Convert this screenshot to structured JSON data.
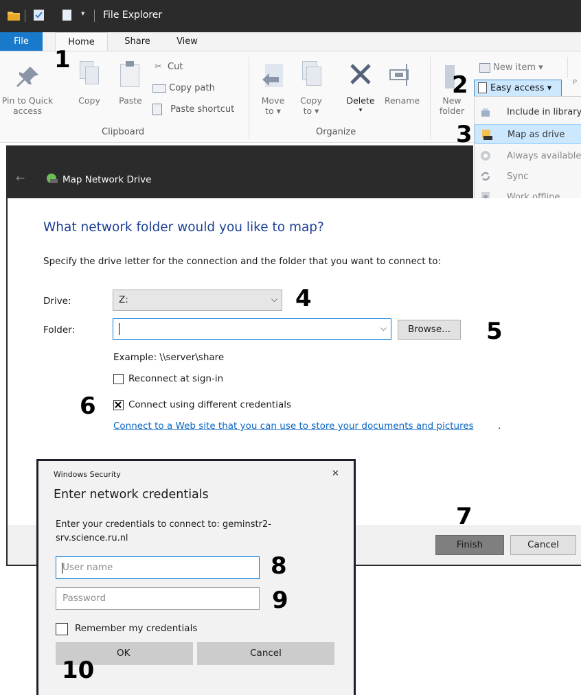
{
  "window": {
    "title": "File Explorer"
  },
  "tabs": {
    "file": "File",
    "home": "Home",
    "share": "Share",
    "view": "View"
  },
  "ribbon": {
    "pin_line1": "Pin to Quick",
    "pin_line2": "access",
    "copy": "Copy",
    "paste": "Paste",
    "cut": "Cut",
    "copy_path": "Copy path",
    "paste_shortcut": "Paste shortcut",
    "clipboard_group": "Clipboard",
    "move_line1": "Move",
    "move_line2": "to ▾",
    "copy_to_line1": "Copy",
    "copy_to_line2": "to ▾",
    "delete": "Delete",
    "delete_arrow": "▾",
    "rename": "Rename",
    "organize_group": "Organize",
    "new_folder_line1": "New",
    "new_folder_line2": "folder",
    "new_item": "New item ▾",
    "easy_access": "Easy access ▾",
    "cut_off_char": "P"
  },
  "easy_access_menu": {
    "items": [
      {
        "label": "Include in library"
      },
      {
        "label": "Map as drive"
      },
      {
        "label": "Always available"
      },
      {
        "label": "Sync"
      },
      {
        "label": "Work offline"
      }
    ]
  },
  "map_drive": {
    "title": "Map Network Drive",
    "heading": "What network folder would you like to map?",
    "instruction": "Specify the drive letter for the connection and the folder that you want to connect to:",
    "drive_label": "Drive:",
    "drive_value": "Z:",
    "folder_label": "Folder:",
    "folder_value": "",
    "browse_label": "Browse...",
    "example": "Example: \\\\server\\share",
    "reconnect_label": "Reconnect at sign-in",
    "reconnect_checked": false,
    "different_credentials_label": "Connect using different credentials",
    "different_credentials_checked": true,
    "link_text": "Connect to a Web site that you can use to store your documents and pictures",
    "link_period": ".",
    "finish_label": "Finish",
    "cancel_label": "Cancel"
  },
  "security_dialog": {
    "caption": "Windows Security",
    "close_glyph": "✕",
    "heading": "Enter network credentials",
    "prompt_line1": "Enter your credentials to connect to: geminstr2-",
    "prompt_line2": "srv.science.ru.nl",
    "username_placeholder": "User name",
    "password_placeholder": "Password",
    "remember_label": "Remember my credentials",
    "remember_checked": false,
    "ok_label": "OK",
    "cancel_label": "Cancel"
  },
  "steps": [
    "1",
    "2",
    "3",
    "4",
    "5",
    "6",
    "7",
    "8",
    "9",
    "10"
  ],
  "colors": {
    "accent": "#1979ca",
    "dialog_heading": "#1c3f94",
    "link": "#0a66c2",
    "selection": "#cce8ff"
  }
}
